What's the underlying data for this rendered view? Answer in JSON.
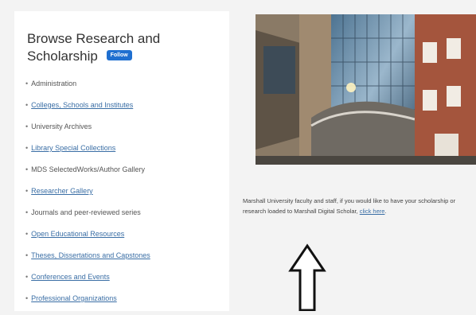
{
  "browse": {
    "title": "Browse Research and Scholarship",
    "follow_label": "Follow",
    "items": [
      {
        "label": "Administration",
        "link": false
      },
      {
        "label": "Colleges, Schools and Institutes",
        "link": true
      },
      {
        "label": "University Archives",
        "link": false
      },
      {
        "label": "Library Special Collections",
        "link": true
      },
      {
        "label": "MDS SelectedWorks/Author Gallery",
        "link": false
      },
      {
        "label": "Researcher Gallery",
        "link": true
      },
      {
        "label": "Journals and peer-reviewed series",
        "link": false
      },
      {
        "label": "Open Educational Resources",
        "link": true
      },
      {
        "label": "Theses, Dissertations and Capstones",
        "link": true
      },
      {
        "label": "Conferences and Events",
        "link": true
      },
      {
        "label": "Professional Organizations",
        "link": true
      }
    ]
  },
  "note": {
    "text_before": "Marshall University faculty and staff, if you would like to have your scholarship or research loaded to Marshall Digital Scholar, ",
    "link_text": "click here",
    "text_after": "."
  },
  "colors": {
    "follow_button": "#1f6fd0",
    "link": "#3a6ea5",
    "background": "#f3f3f3"
  }
}
